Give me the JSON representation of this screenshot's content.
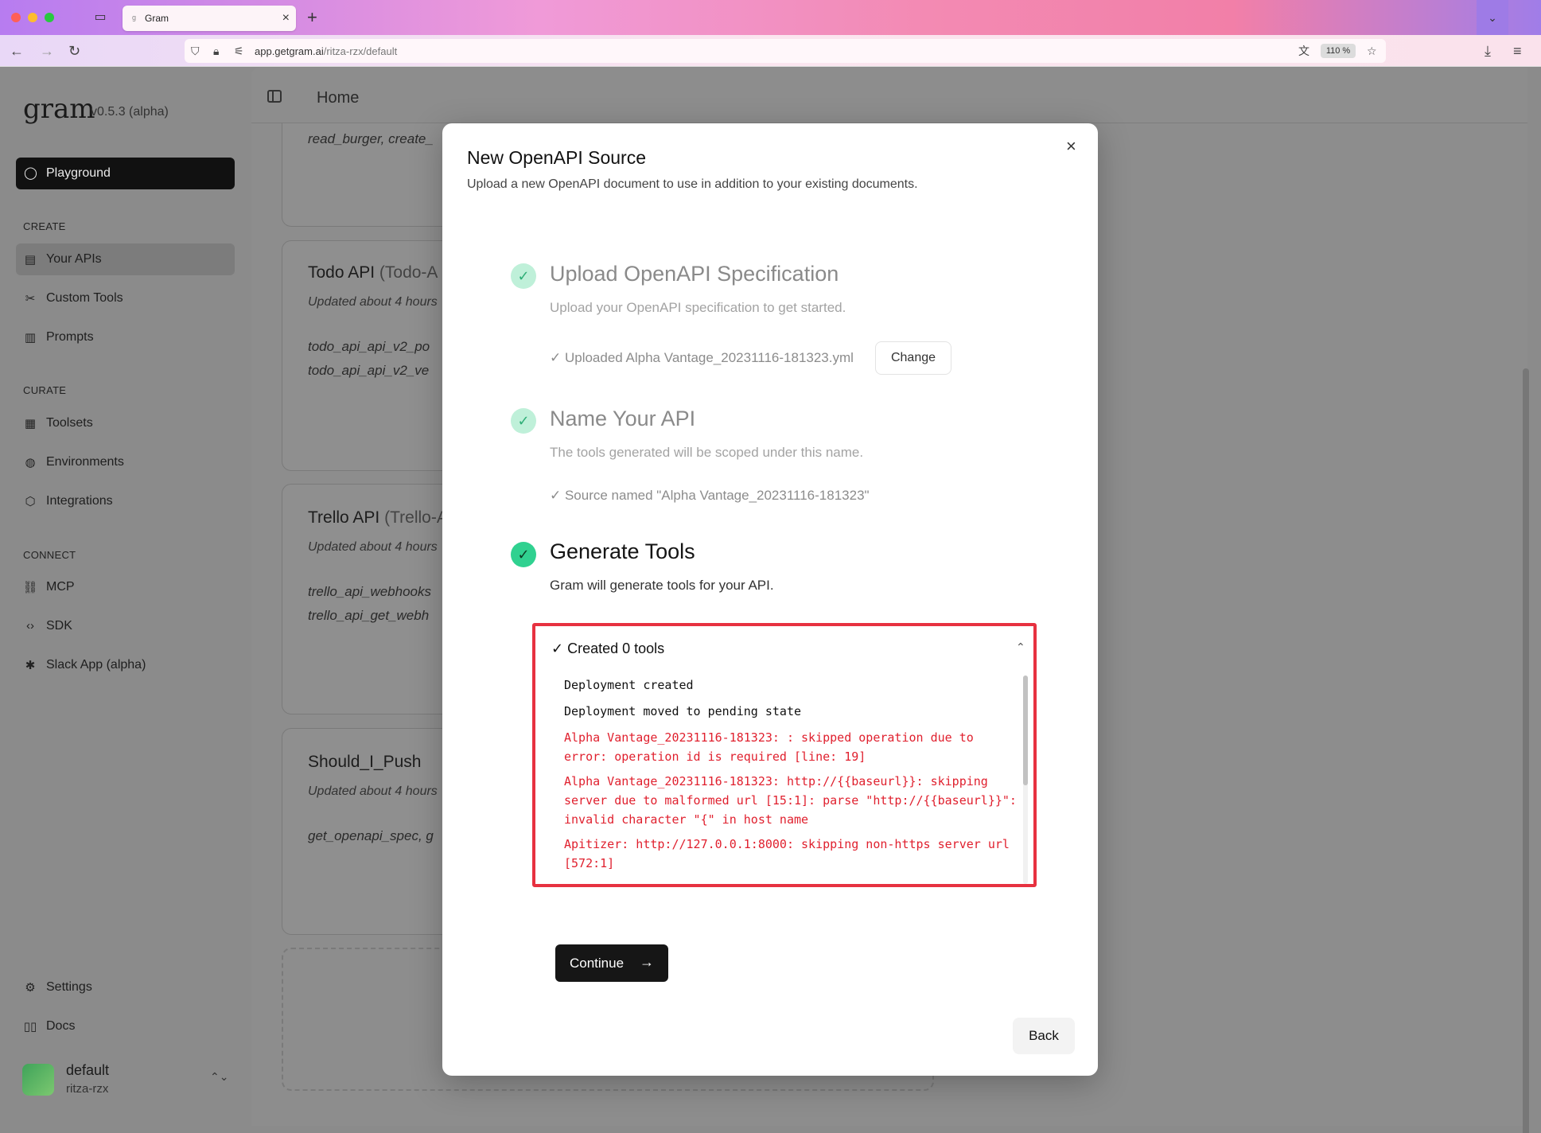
{
  "browser": {
    "tab_title": "Gram",
    "tab_favicon": "g",
    "url_domain": "app.getgram.ai",
    "url_path": "/ritza-rzx/default",
    "zoom": "110 %"
  },
  "sidebar": {
    "logo": "gram",
    "version": "v0.5.3 (alpha)",
    "playground_label": "Playground",
    "sections": {
      "create": "CREATE",
      "curate": "CURATE",
      "connect": "CONNECT"
    },
    "items": {
      "your_apis": "Your APIs",
      "custom_tools": "Custom Tools",
      "prompts": "Prompts",
      "toolsets": "Toolsets",
      "environments": "Environments",
      "integrations": "Integrations",
      "mcp": "MCP",
      "sdk": "SDK",
      "slack": "Slack App (alpha)",
      "settings": "Settings",
      "docs": "Docs"
    },
    "workspace": {
      "name": "default",
      "slug": "ritza-rzx"
    }
  },
  "header": {
    "title": "Home"
  },
  "cards": {
    "c0": {
      "tools": "read_burger, create_"
    },
    "c1": {
      "title": "Todo API",
      "slug": "(Todo-A",
      "updated": "Updated about 4 hours",
      "tool1": "todo_api_api_v2_po",
      "tool2": "todo_api_api_v2_ve"
    },
    "c2": {
      "title": "Trello API",
      "slug": "(Trello-A",
      "updated": "Updated about 4 hours",
      "tool1": "trello_api_webhooks",
      "tool2": "trello_api_get_webh"
    },
    "c3": {
      "title": "Should_I_Push",
      "updated": "Updated about 4 hours",
      "tool1": "get_openapi_spec, g"
    }
  },
  "modal": {
    "title": "New OpenAPI Source",
    "subtitle": "Upload a new OpenAPI document to use in addition to your existing documents.",
    "close_icon": "×",
    "step1": {
      "title": "Upload OpenAPI Specification",
      "desc": "Upload your OpenAPI specification to get started.",
      "note": "✓ Uploaded Alpha Vantage_20231116-181323.yml",
      "change_label": "Change"
    },
    "step2": {
      "title": "Name Your API",
      "desc": "The tools generated will be scoped under this name.",
      "note": "✓ Source named \"Alpha Vantage_20231116-181323\""
    },
    "step3": {
      "title": "Generate Tools",
      "desc": "Gram will generate tools for your API."
    },
    "log": {
      "header": "✓ Created 0 tools",
      "lines": [
        "Deployment created",
        "Deployment moved to pending state",
        "Alpha Vantage_20231116-181323: : skipped operation due to error: operation id is required [line: 19]",
        "Alpha Vantage_20231116-181323: http://{{baseurl}}: skipping server due to malformed url [15:1]: parse \"http://{{baseurl}}\": invalid character \"{\" in host name",
        "Apitizer: http://127.0.0.1:8000: skipping non-https server url [572:1]"
      ]
    },
    "continue_label": "Continue",
    "back_label": "Back"
  },
  "colors": {
    "error": "#e0202e",
    "highlight_border": "#e73140",
    "success": "#30d190"
  }
}
